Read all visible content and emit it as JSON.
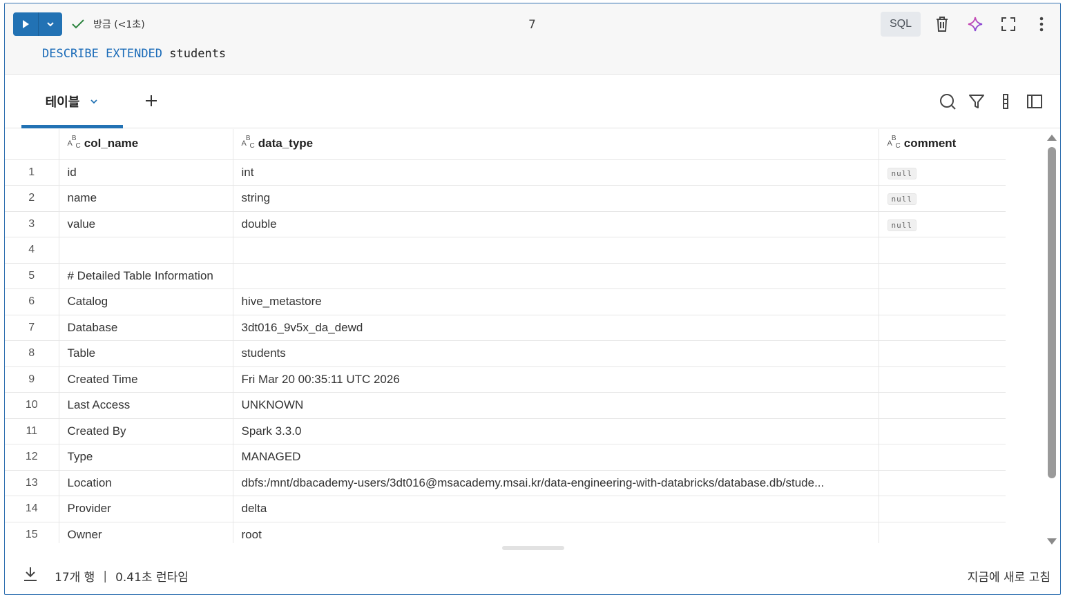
{
  "cell": {
    "status_text": "방금 (<1초)",
    "cell_number": "7",
    "language": "SQL",
    "code": {
      "keyword1": "DESCRIBE",
      "keyword2": "EXTENDED",
      "identifier": "students"
    }
  },
  "results": {
    "tab_label": "테이블",
    "columns": [
      "col_name",
      "data_type",
      "comment"
    ],
    "column_type_icon": "abc-type-icon",
    "rows": [
      {
        "n": "1",
        "col_name": "id",
        "data_type": "int",
        "comment": "null"
      },
      {
        "n": "2",
        "col_name": "name",
        "data_type": "string",
        "comment": "null"
      },
      {
        "n": "3",
        "col_name": "value",
        "data_type": "double",
        "comment": "null"
      },
      {
        "n": "4",
        "col_name": "",
        "data_type": "",
        "comment": ""
      },
      {
        "n": "5",
        "col_name": "# Detailed Table Information",
        "data_type": "",
        "comment": ""
      },
      {
        "n": "6",
        "col_name": "Catalog",
        "data_type": "hive_metastore",
        "comment": ""
      },
      {
        "n": "7",
        "col_name": "Database",
        "data_type": "3dt016_9v5x_da_dewd",
        "comment": ""
      },
      {
        "n": "8",
        "col_name": "Table",
        "data_type": "students",
        "comment": ""
      },
      {
        "n": "9",
        "col_name": "Created Time",
        "data_type": "Fri Mar 20 00:35:11 UTC 2026",
        "comment": ""
      },
      {
        "n": "10",
        "col_name": "Last Access",
        "data_type": "UNKNOWN",
        "comment": ""
      },
      {
        "n": "11",
        "col_name": "Created By",
        "data_type": "Spark 3.3.0",
        "comment": ""
      },
      {
        "n": "12",
        "col_name": "Type",
        "data_type": "MANAGED",
        "comment": ""
      },
      {
        "n": "13",
        "col_name": "Location",
        "data_type": "dbfs:/mnt/dbacademy-users/3dt016@msacademy.msai.kr/data-engineering-with-databricks/database.db/stude...",
        "comment": ""
      },
      {
        "n": "14",
        "col_name": "Provider",
        "data_type": "delta",
        "comment": ""
      },
      {
        "n": "15",
        "col_name": "Owner",
        "data_type": "root",
        "comment": ""
      }
    ]
  },
  "footer": {
    "row_count": "17개 행",
    "separator": "|",
    "runtime": "0.41초 런타임",
    "refreshed": "지금에 새로 고침"
  },
  "colors": {
    "accent": "#2272b4",
    "success": "#2e8540",
    "sql_keyword": "#1a6bb8"
  }
}
